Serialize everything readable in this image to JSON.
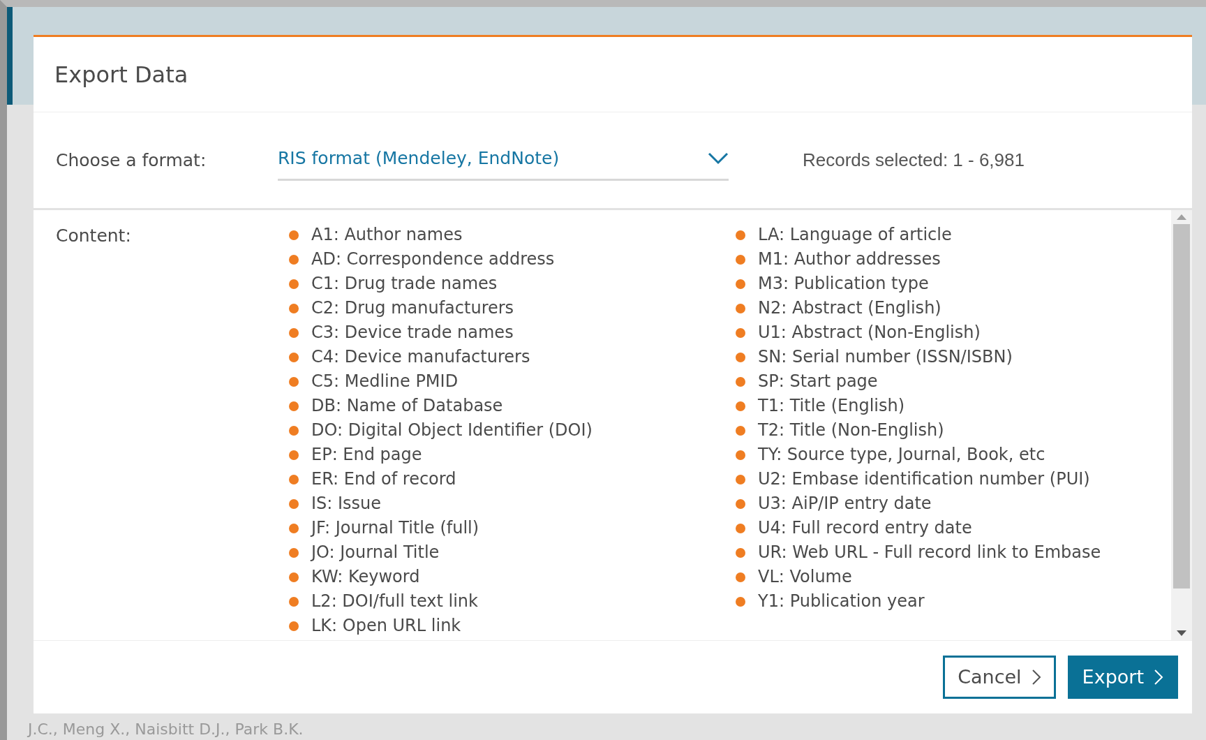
{
  "background": {
    "author_line": "J.C., Meng X., Naisbitt D.J., Park B.K."
  },
  "dialog": {
    "title": "Export Data",
    "format": {
      "label": "Choose a format:",
      "value": "RIS format (Mendeley, EndNote)"
    },
    "records": "Records selected: 1 - 6,981",
    "content": {
      "label": "Content:",
      "columns": [
        [
          "A1: Author names",
          "AD: Correspondence address",
          "C1: Drug trade names",
          "C2: Drug manufacturers",
          "C3: Device trade names",
          "C4: Device manufacturers",
          "C5: Medline PMID",
          "DB: Name of Database",
          "DO: Digital Object Identifier (DOI)",
          "EP: End page",
          "ER: End of record",
          "IS: Issue",
          "JF: Journal Title (full)",
          "JO: Journal Title",
          "KW: Keyword",
          "L2: DOI/full text link",
          "LK: Open URL link"
        ],
        [
          "LA: Language of article",
          "M1: Author addresses",
          "M3: Publication type",
          "N2: Abstract (English)",
          "U1: Abstract (Non-English)",
          "SN: Serial number (ISSN/ISBN)",
          "SP: Start page",
          "T1: Title (English)",
          "T2: Title (Non-English)",
          "TY: Source type, Journal, Book, etc",
          "U2: Embase identification number (PUI)",
          "U3: AiP/IP entry date",
          "U4: Full record entry date",
          "UR: Web URL - Full record link to Embase",
          "VL: Volume",
          "Y1: Publication year"
        ]
      ]
    },
    "buttons": [
      {
        "label": "Cancel",
        "kind": "secondary"
      },
      {
        "label": "Export",
        "kind": "primary"
      }
    ]
  }
}
